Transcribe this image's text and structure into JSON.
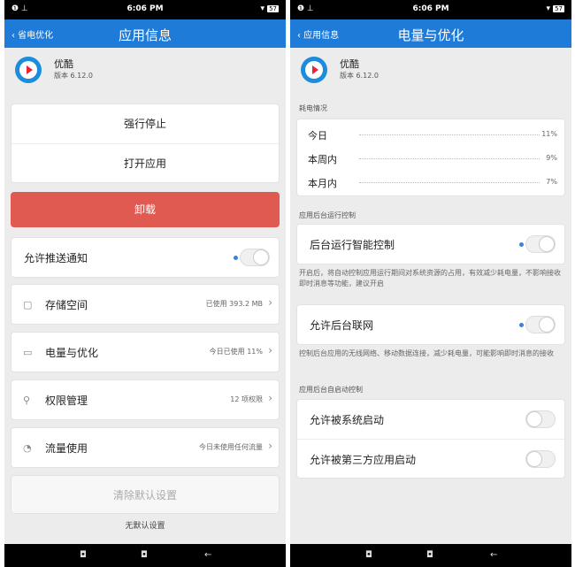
{
  "left": {
    "status": {
      "left": "❶ ⊥",
      "time": "6:06 PM",
      "right": "▾",
      "battery": "57"
    },
    "nav": {
      "back": "‹ 省电优化",
      "title": "应用信息"
    },
    "app": {
      "name": "优酷",
      "version": "版本 6.12.0"
    },
    "actions": {
      "force_stop": "强行停止",
      "open_app": "打开应用",
      "uninstall": "卸载"
    },
    "push": {
      "label": "允许推送通知"
    },
    "storage": {
      "label": "存储空间",
      "value": "已使用 393.2 MB"
    },
    "battery_opt": {
      "label": "电量与优化",
      "value": "今日已使用 11%"
    },
    "permissions": {
      "label": "权限管理",
      "value": "12 项权限"
    },
    "traffic": {
      "label": "流量使用",
      "value": "今日未使用任何流量"
    },
    "clear_defaults": {
      "label": "清除默认设置"
    },
    "no_defaults": "无默认设置",
    "bottom": {
      "home": "◘",
      "recents": "◘",
      "back": "←"
    }
  },
  "right": {
    "status": {
      "left": "❶ ⊥",
      "time": "6:06 PM",
      "right": "▾",
      "battery": "57"
    },
    "nav": {
      "back": "‹ 应用信息",
      "title": "电量与优化"
    },
    "app": {
      "name": "优酷",
      "version": "版本 6.12.0"
    },
    "usage_title": "耗电情况",
    "usage": [
      {
        "label": "今日",
        "value": "11%"
      },
      {
        "label": "本周内",
        "value": "9%"
      },
      {
        "label": "本月内",
        "value": "7%"
      }
    ],
    "bg_control_title": "应用后台运行控制",
    "smart_control": {
      "label": "后台运行智能控制"
    },
    "smart_desc": "开启后，将自动控制应用运行期间对系统资源的占用，有效减少耗电量，不影响接收即时消息等功能，建议开启",
    "bg_network": {
      "label": "允许后台联网"
    },
    "bg_network_desc": "控制后台应用的无线网络、移动数据连接，减少耗电量，可能影响即时消息的接收",
    "autostart_title": "应用后台自启动控制",
    "system_start": {
      "label": "允许被系统启动"
    },
    "third_party_start": {
      "label": "允许被第三方应用启动"
    },
    "bottom": {
      "home": "◘",
      "recents": "◘",
      "back": "←"
    }
  }
}
